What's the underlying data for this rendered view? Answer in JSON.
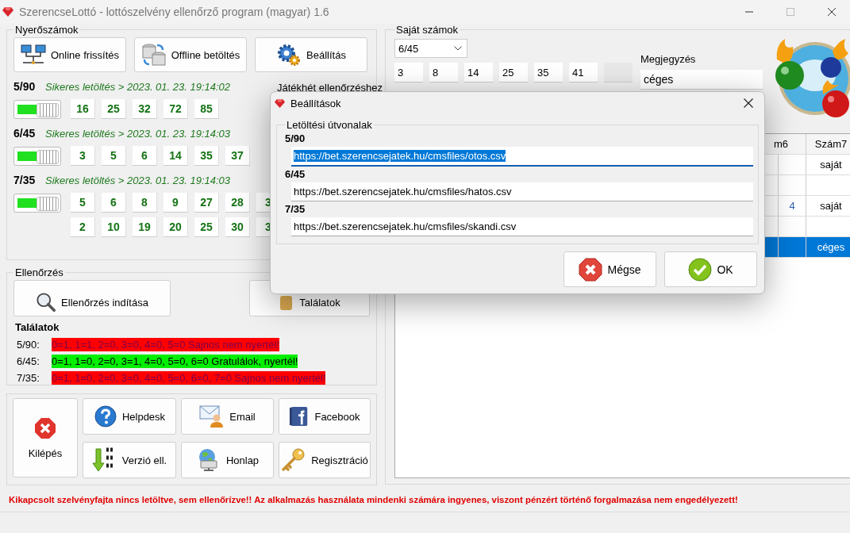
{
  "window": {
    "title": "SzerencseLottó - lottószelvény ellenőrző program (magyar) 1.6"
  },
  "winning": {
    "title": "Nyerőszámok",
    "buttons": [
      "Online frissítés",
      "Offline betöltés",
      "Beállítás"
    ],
    "week_label": "Játékhét ellenőrzéshez",
    "games": [
      {
        "name": "5/90",
        "status": "Sikeres letöltés > 2023. 01. 23. 19:14:02",
        "on": true,
        "rows": [
          [
            "16",
            "25",
            "32",
            "72",
            "85"
          ]
        ]
      },
      {
        "name": "6/45",
        "status": "Sikeres letöltés > 2023. 01. 23. 19:14:03",
        "on": true,
        "rows": [
          [
            "3",
            "5",
            "6",
            "14",
            "35",
            "37"
          ]
        ]
      },
      {
        "name": "7/35",
        "status": "Sikeres letöltés > 2023. 01. 23. 19:14:03",
        "on": true,
        "rows": [
          [
            "5",
            "6",
            "8",
            "9",
            "27",
            "28",
            "3"
          ],
          [
            "2",
            "10",
            "19",
            "20",
            "25",
            "30",
            "3"
          ]
        ]
      }
    ]
  },
  "check": {
    "title": "Ellenőrzés",
    "buttons": [
      "Ellenőrzés indítása",
      "Találatok"
    ],
    "results_title": "Találatok",
    "results": [
      {
        "game": "5/90:",
        "text": "0=1, 1=1, 2=0, 3=0, 4=0, 5=0 Sajnos nem nyertél!",
        "won": false
      },
      {
        "game": "6/45:",
        "text": "0=1, 1=0, 2=0, 3=1, 4=0, 5=0, 6=0 Gratulálok, nyertél!",
        "won": true
      },
      {
        "game": "7/35:",
        "text": "0=1, 1=0, 2=0, 3=0, 4=0, 5=0, 6=0, 7=0 Sajnos nem nyertél!",
        "won": false
      }
    ]
  },
  "actions": {
    "exit": "Kilépés",
    "buttons": [
      "Helpdesk",
      "Email",
      "Facebook",
      "Verzió ell.",
      "Honlap",
      "Regisztráció"
    ]
  },
  "footer": "Kikapcsolt szelvényfajta nincs letöltve, sem ellenőrízve!!  Az alkalmazás használata mindenki számára ingyenes, viszont pénzért történő forgalmazása nem engedélyezett!",
  "own": {
    "title": "Saját számok",
    "game_select": "6/45",
    "numbers": [
      "3",
      "8",
      "14",
      "25",
      "35",
      "41"
    ],
    "note_label": "Megjegyzés",
    "note": "céges",
    "table": {
      "columns": [
        "m6",
        "Szám7"
      ],
      "rows": [
        {
          "selected": false,
          "column_7": "saját"
        },
        {
          "selected": false
        },
        {
          "selected": false,
          "column_6": "4",
          "column_7": "saját"
        },
        {
          "selected": false
        },
        {
          "selected": true,
          "column_7": "céges"
        }
      ]
    }
  },
  "dialog": {
    "title": "Beállítások",
    "group": "Letöltési útvonalak",
    "paths": [
      {
        "label": "5/90",
        "value": "https://bet.szerencsejatek.hu/cmsfiles/otos.csv",
        "focused": true
      },
      {
        "label": "6/45",
        "value": "https://bet.szerencsejatek.hu/cmsfiles/hatos.csv",
        "focused": false
      },
      {
        "label": "7/35",
        "value": "https://bet.szerencsejatek.hu/cmsfiles/skandi.csv",
        "focused": false
      }
    ],
    "buttons": [
      {
        "label": "Mégse",
        "kind": "cancel"
      },
      {
        "label": "OK",
        "kind": "ok"
      }
    ]
  }
}
